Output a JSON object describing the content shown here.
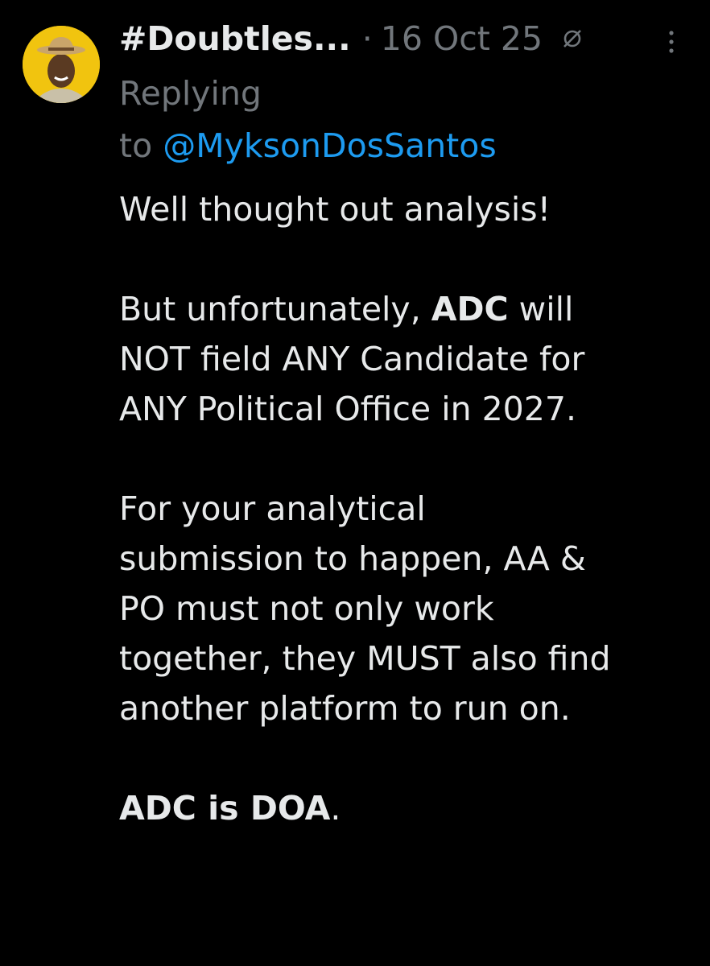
{
  "tweet": {
    "display_name": "#Doubtles...",
    "separator": "·",
    "date": "16 Oct 25",
    "reply_prefix": "Replying",
    "reply_to": "to",
    "reply_handle": "@MyksonDosSantos",
    "paragraph1": "Well thought out analysis!",
    "p2_l1_pre": "But unfortunately, ",
    "p2_l1_bold": "ADC",
    "p2_l1_post": " will",
    "p2_l2": "NOT field ANY Candidate for",
    "p2_l3": "ANY Political Office in 2027.",
    "p3_l1": "For your analytical",
    "p3_l2": "submission to happen, AA &",
    "p3_l3": "PO must not only work",
    "p3_l4": "together, they MUST also find",
    "p3_l5": "another platform to run on.",
    "p4_bold": "ADC is DOA",
    "p4_post": "."
  },
  "icons": {
    "avatar": "user-avatar",
    "no_edit": "no-edit-icon",
    "more": "more-options-icon"
  },
  "colors": {
    "background": "#000000",
    "text": "#e7e9ea",
    "muted": "#71767b",
    "link": "#1d9bf0"
  }
}
